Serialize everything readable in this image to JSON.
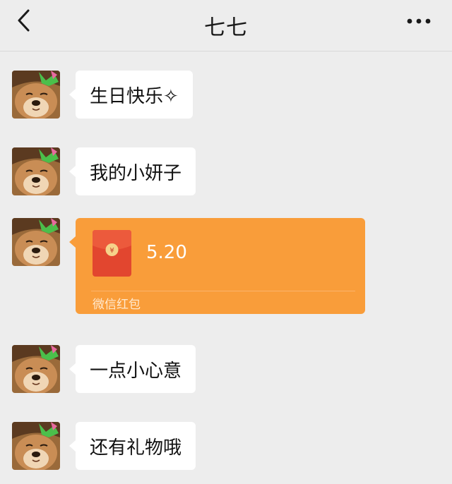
{
  "header": {
    "title": "七七",
    "back_icon": "chevron-left-icon",
    "more_icon": "more-horizontal-icon"
  },
  "messages": [
    {
      "type": "text",
      "text": "生日快乐✧"
    },
    {
      "type": "text",
      "text": "我的小妍子"
    },
    {
      "type": "red_packet",
      "amount": "5.20",
      "label": "微信红包",
      "icon": "red-envelope-icon"
    },
    {
      "type": "text",
      "text": "一点小心意"
    },
    {
      "type": "text",
      "text": "还有礼物哦"
    }
  ],
  "colors": {
    "background": "#ededed",
    "bubble": "#ffffff",
    "red_packet": "#f99d3a",
    "envelope": "#e2462f"
  }
}
